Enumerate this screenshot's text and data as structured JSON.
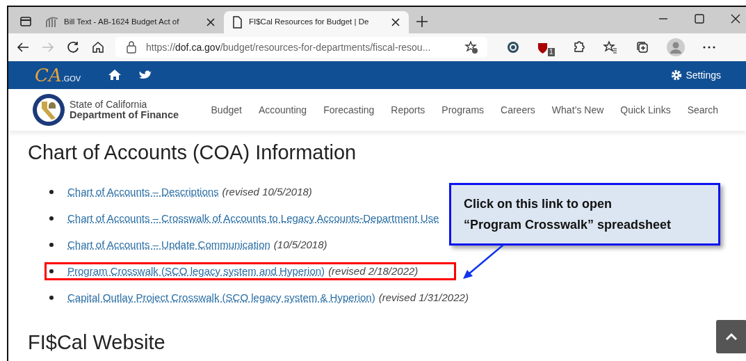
{
  "browser": {
    "tabs": [
      {
        "title": "Bill Text - AB-1624 Budget Act of",
        "selected": false
      },
      {
        "title": "FI$Cal Resources for Budget | De",
        "selected": true
      }
    ],
    "url": {
      "scheme": "https://",
      "host": "dof.ca.gov",
      "path": "/budget/resources-for-departments/fiscal-resou..."
    },
    "extension_badge": "1"
  },
  "utility_bar": {
    "logo": "CA",
    "logo_suffix": ".GOV",
    "settings": "Settings"
  },
  "header": {
    "org_line1": "State of California",
    "org_line2": "Department of Finance",
    "nav": [
      "Budget",
      "Accounting",
      "Forecasting",
      "Reports",
      "Programs",
      "Careers",
      "What’s New",
      "Quick Links",
      "Search"
    ]
  },
  "content": {
    "heading": "Chart of Accounts (COA) Information",
    "items": [
      {
        "link": "Chart of Accounts – Descriptions",
        "note": "(revised 10/5/2018)",
        "highlighted": false
      },
      {
        "link": "Chart of Accounts – Crosswalk of Accounts to Legacy Accounts-Department Use",
        "highlighted": false
      },
      {
        "link": "Chart of Accounts – Update Communication",
        "note": "(10/5/2018)",
        "highlighted": false
      },
      {
        "link": "Program Crosswalk (SCO legacy system and Hyperion)",
        "note": "(revised 2/18/2022)",
        "highlighted": true
      },
      {
        "link": "Capital Outlay Project Crosswalk (SCO legacy system & Hyperion)",
        "note": "(revised 1/31/2022)",
        "highlighted": false
      }
    ],
    "heading_2": "FI$Cal Website"
  },
  "callout": {
    "lines": [
      "Click on this link to open",
      "“Program Crosswalk” spreadsheet"
    ]
  }
}
